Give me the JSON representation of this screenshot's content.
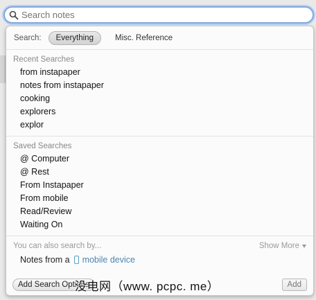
{
  "search": {
    "placeholder": "Search notes",
    "value": ""
  },
  "scope": {
    "label": "Search:",
    "options": [
      "Everything",
      "Misc. Reference"
    ],
    "selected": "Everything"
  },
  "recent": {
    "title": "Recent Searches",
    "items": [
      "from instapaper",
      "notes from instapaper",
      "cooking",
      "explorers",
      "explor"
    ]
  },
  "saved": {
    "title": "Saved Searches",
    "items": [
      "@ Computer",
      "@ Rest",
      "From Instapaper",
      "From mobile",
      "Read/Review",
      "Waiting On"
    ]
  },
  "also": {
    "title": "You can also search by...",
    "show_more": "Show More",
    "prefix": "Notes from a",
    "device": "mobile device"
  },
  "footer": {
    "add_options": "Add Search Options",
    "add": "Add"
  },
  "watermark": "没电网（www. pcpc. me）",
  "colors": {
    "focus_ring": "#7fa9df",
    "link": "#4c86b5"
  }
}
